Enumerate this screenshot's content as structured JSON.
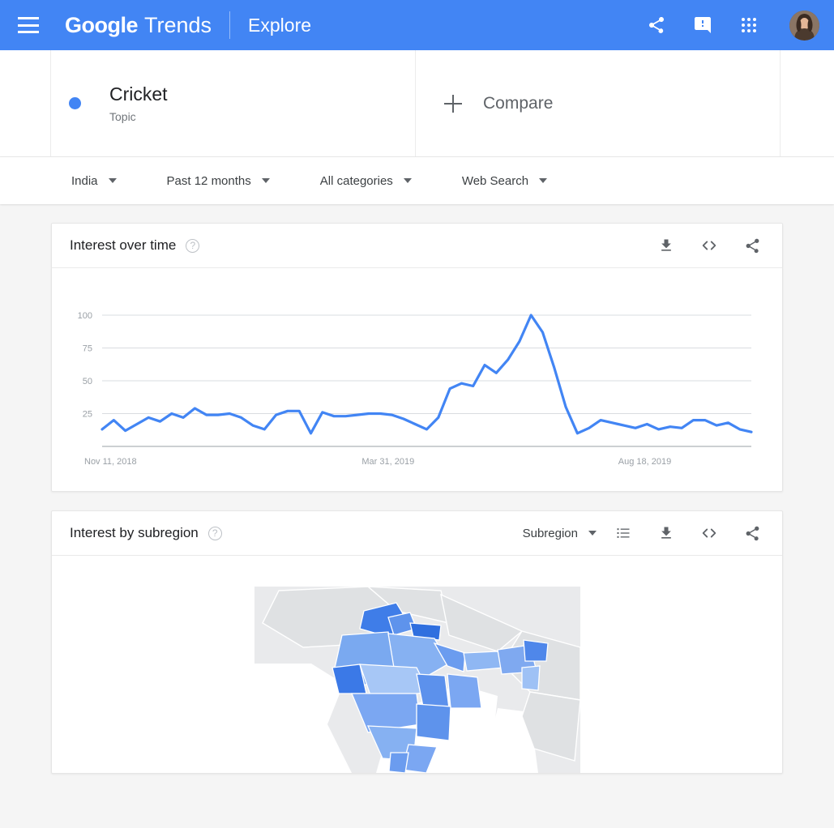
{
  "appbar": {
    "menu_icon": "hamburger-menu-icon",
    "brand_google": "Google",
    "brand_product": "Trends",
    "explore": "Explore",
    "share_icon": "share-icon",
    "feedback_icon": "feedback-icon",
    "apps_icon": "apps-grid-icon",
    "avatar": "user-avatar",
    "background": "#4285f4"
  },
  "terms": {
    "items": [
      {
        "title": "Cricket",
        "subtitle": "Topic",
        "color": "#4285f4"
      }
    ],
    "compare_label": "Compare",
    "add_icon": "plus-icon"
  },
  "filters": [
    {
      "label": "India",
      "name": "location-filter"
    },
    {
      "label": "Past 12 months",
      "name": "time-range-filter"
    },
    {
      "label": "All categories",
      "name": "category-filter"
    },
    {
      "label": "Web Search",
      "name": "search-type-filter"
    }
  ],
  "interest_over_time": {
    "title": "Interest over time",
    "help_icon": "help-icon",
    "actions": [
      {
        "name": "download-icon",
        "label": "Download"
      },
      {
        "name": "embed-icon",
        "label": "Embed"
      },
      {
        "name": "share-icon",
        "label": "Share"
      }
    ]
  },
  "interest_by_subregion": {
    "title": "Interest by subregion",
    "help_icon": "help-icon",
    "select_label": "Subregion",
    "actions": [
      {
        "name": "list-view-icon",
        "label": "List view"
      },
      {
        "name": "download-icon",
        "label": "Download"
      },
      {
        "name": "embed-icon",
        "label": "Embed"
      },
      {
        "name": "share-icon",
        "label": "Share"
      }
    ]
  },
  "chart_data": {
    "type": "line",
    "title": "Interest over time",
    "xlabel": "",
    "ylabel": "",
    "ylim": [
      0,
      100
    ],
    "yticks": [
      25,
      50,
      75,
      100
    ],
    "xticks": [
      "Nov 11, 2018",
      "Mar 31, 2019",
      "Aug 18, 2019"
    ],
    "grid": true,
    "legend": false,
    "line_color": "#4285f4",
    "series": [
      {
        "name": "Cricket",
        "values": [
          13,
          20,
          12,
          17,
          22,
          19,
          25,
          22,
          29,
          24,
          24,
          25,
          22,
          16,
          13,
          24,
          27,
          27,
          10,
          26,
          23,
          23,
          24,
          25,
          25,
          24,
          21,
          17,
          13,
          22,
          44,
          48,
          46,
          62,
          56,
          66,
          80,
          100,
          87,
          60,
          30,
          10,
          14,
          20,
          18,
          16,
          14,
          17,
          13,
          15,
          14,
          20,
          20,
          16,
          18,
          13,
          11
        ]
      }
    ]
  },
  "map": {
    "region": "India",
    "scale_colors": [
      "#e8eaed",
      "#c6dafc",
      "#a3c2f7",
      "#7ba7f2",
      "#4285f4",
      "#2a64d9"
    ]
  }
}
